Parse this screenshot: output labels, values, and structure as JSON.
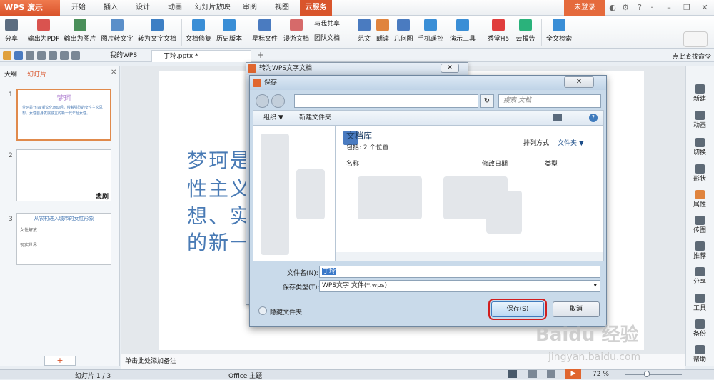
{
  "app": {
    "logo": "WPS 演示",
    "login": "未登录"
  },
  "tabs": [
    "开始",
    "插入",
    "设计",
    "动画",
    "幻灯片放映",
    "审阅",
    "视图",
    "云服务"
  ],
  "ribbon": [
    "分享",
    "输出为PDF",
    "输出为图片",
    "图片转文字",
    "转为文字文档",
    "文档修复",
    "历史版本",
    "星标文件",
    "漫游文档",
    "与我共享",
    "团队文档",
    "范文",
    "朗读",
    "几何图",
    "手机遥控",
    "演示工具",
    "秀堂H5",
    "云报告",
    "全文检索"
  ],
  "ribbon_small": {
    "share_with_me": "与我共享",
    "team_docs": "团队文档"
  },
  "doc_tabs": [
    "我的WPS",
    "丁玲.pptx *"
  ],
  "search_hint": "点此查找命令",
  "leftpane": {
    "tab_outline": "大纲",
    "tab_slides": "幻灯片"
  },
  "slides": [
    {
      "num": "1",
      "title": "梦珂",
      "body": "梦珂是'五四'新文化运动后，带着强烈的女性主义思想，女性自身发展独立的新一代年轻女性。"
    },
    {
      "num": "2",
      "label": "悲剧"
    },
    {
      "num": "3",
      "title": "从农村进入城市的女性形象",
      "items": [
        "女性解放",
        "现实世界"
      ]
    }
  ],
  "slide_text": [
    "梦珂是",
    "性主义",
    "想、实",
    "的新一"
  ],
  "notes": "单击此处添加备注",
  "status": {
    "slide": "幻灯片 1 / 3",
    "theme": "Office 主题",
    "zoom": "72 %"
  },
  "rightbar": [
    "新建",
    "动画",
    "切换",
    "形状",
    "属性",
    "传图",
    "推荐",
    "分享",
    "工具",
    "备份",
    "帮助"
  ],
  "dialog_back": {
    "title": "转为WPS文字文档"
  },
  "dialog": {
    "title": "保存",
    "search_placeholder": "搜索 文档",
    "organize": "组织 ▼",
    "new_folder": "新建文件夹",
    "library_title": "文档库",
    "library_sub": "包括: 2 个位置",
    "sort_label": "排列方式:",
    "sort_value": "文件夹 ▼",
    "col_name": "名称",
    "col_date": "修改日期",
    "col_type": "类型",
    "filename_label": "文件名(N):",
    "filename_value": "丁玲",
    "filetype_label": "保存类型(T):",
    "filetype_value": "WPS文字 文件(*.wps)",
    "hide_folders": "隐藏文件夹",
    "save": "保存(S)",
    "cancel": "取消"
  },
  "watermark": {
    "main": "Baidu 经验",
    "sub": "jingyan.baidu.com"
  }
}
